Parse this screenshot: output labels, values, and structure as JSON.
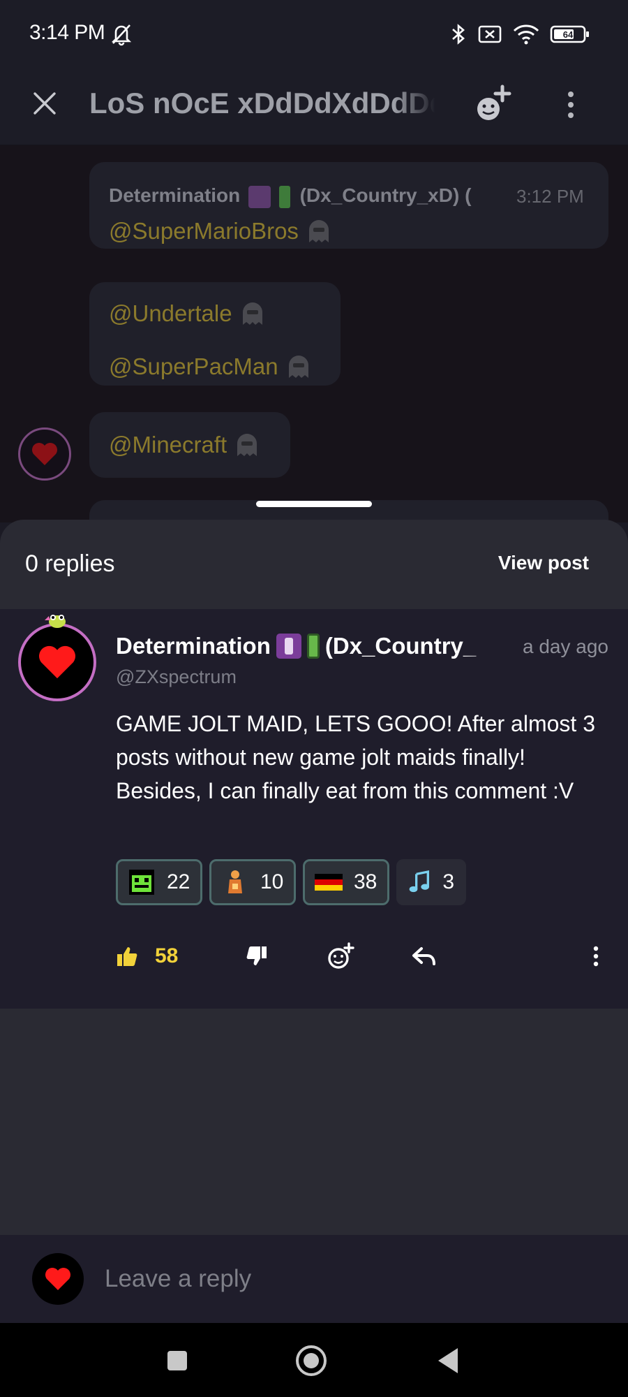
{
  "status_bar": {
    "time": "3:14 PM",
    "battery": "64",
    "icons": [
      "bell-off-icon",
      "bluetooth-icon",
      "no-sim-icon",
      "wifi-icon",
      "battery-icon"
    ]
  },
  "header": {
    "title": "LoS nOcE xDdDdXdDdDd",
    "close_icon": "close-icon",
    "add_emoji_icon": "add-emoji-icon",
    "more_icon": "more-vertical-icon"
  },
  "chat": {
    "message": {
      "author": "Determination",
      "author_handle": "(Dx_Country_xD) (",
      "time": "3:12 PM",
      "mentions": [
        "@SuperMarioBros",
        "@Undertale",
        "@SuperPacMan",
        "@Minecraft"
      ]
    }
  },
  "sheet": {
    "replies_label": "0 replies",
    "view_post_label": "View post",
    "comment": {
      "author": "Determination",
      "author_handle": "(Dx_Country_",
      "time": "a day ago",
      "username": "@ZXspectrum",
      "text": "GAME JOLT MAID, LETS GOOO! After almost 3 posts without new game jolt maids finally! Besides, I can finally eat from this comment :V",
      "reactions": [
        {
          "icon": "green-monster-icon",
          "count": "22"
        },
        {
          "icon": "orange-figure-icon",
          "count": "10"
        },
        {
          "icon": "germany-flag-icon",
          "count": "38"
        },
        {
          "icon": "music-note-icon",
          "count": "3"
        }
      ],
      "likes": "58"
    },
    "reply_placeholder": "Leave a reply"
  },
  "colors": {
    "accent_yellow": "#f2d23a",
    "mention_gold": "#8b7a2c",
    "avatar_ring": "#c46ec4",
    "reaction_border": "#4d6c6c"
  }
}
